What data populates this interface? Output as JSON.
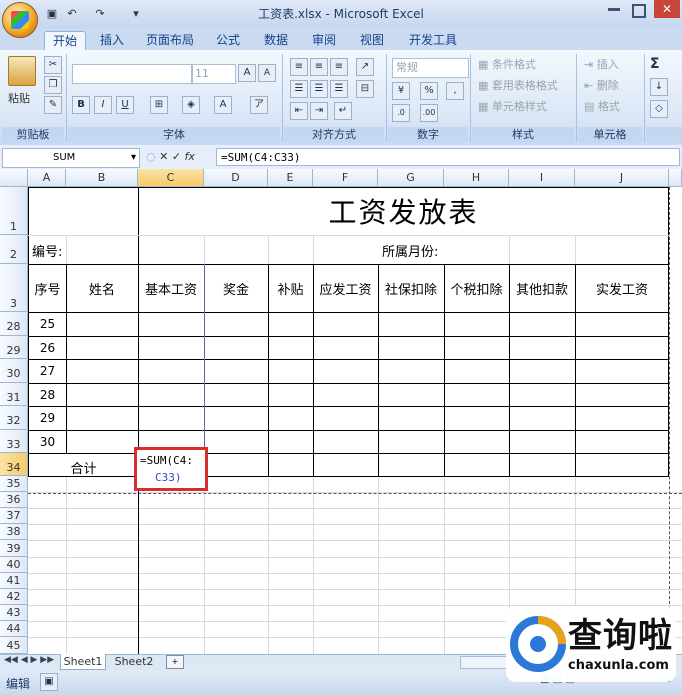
{
  "window": {
    "title": "工资表.xlsx - Microsoft Excel"
  },
  "ribbon": {
    "tabs": [
      "开始",
      "插入",
      "页面布局",
      "公式",
      "数据",
      "审阅",
      "视图",
      "开发工具"
    ],
    "active_tab": "开始",
    "clipboard": {
      "paste_label": "粘贴",
      "group": "剪贴板"
    },
    "font": {
      "size": "11",
      "group": "字体",
      "bold": "B",
      "italic": "I",
      "underline": "U"
    },
    "alignment": {
      "group": "对齐方式"
    },
    "number": {
      "format": "常规",
      "group": "数字",
      "percent": "%"
    },
    "styles": {
      "conditional": "条件格式",
      "table": "套用表格格式",
      "cell": "单元格样式",
      "group": "样式"
    },
    "cells": {
      "insert": "插入",
      "delete": "删除",
      "format": "格式",
      "group": "单元格"
    },
    "editing": {
      "sigma": "Σ"
    }
  },
  "formula_bar": {
    "name_box": "SUM",
    "formula": "=SUM(C4:C33)"
  },
  "sheet": {
    "columns": [
      "A",
      "B",
      "C",
      "D",
      "E",
      "F",
      "G",
      "H",
      "I",
      "J"
    ],
    "title": "工资发放表",
    "row2_left": "编号:",
    "row2_right": "所属月份:",
    "headers": [
      "序号",
      "姓名",
      "基本工资",
      "奖金",
      "补贴",
      "应发工资",
      "社保扣除",
      "个税扣除",
      "其他扣款",
      "实发工资"
    ],
    "row_numbers": [
      "1",
      "2",
      "3",
      "28",
      "29",
      "30",
      "31",
      "32",
      "33",
      "34",
      "35",
      "36",
      "37",
      "38",
      "39",
      "40",
      "41",
      "42",
      "43",
      "44",
      "45"
    ],
    "serials": [
      "25",
      "26",
      "27",
      "28",
      "29",
      "30"
    ],
    "total_label": "合计",
    "edit_line1": "=SUM(C4:",
    "edit_line2": "C33)"
  },
  "sheet_tabs": [
    "Sheet1",
    "Sheet2"
  ],
  "status": {
    "mode": "编辑"
  },
  "watermark": {
    "name": "查询啦",
    "domain": "chaxunla.com"
  }
}
